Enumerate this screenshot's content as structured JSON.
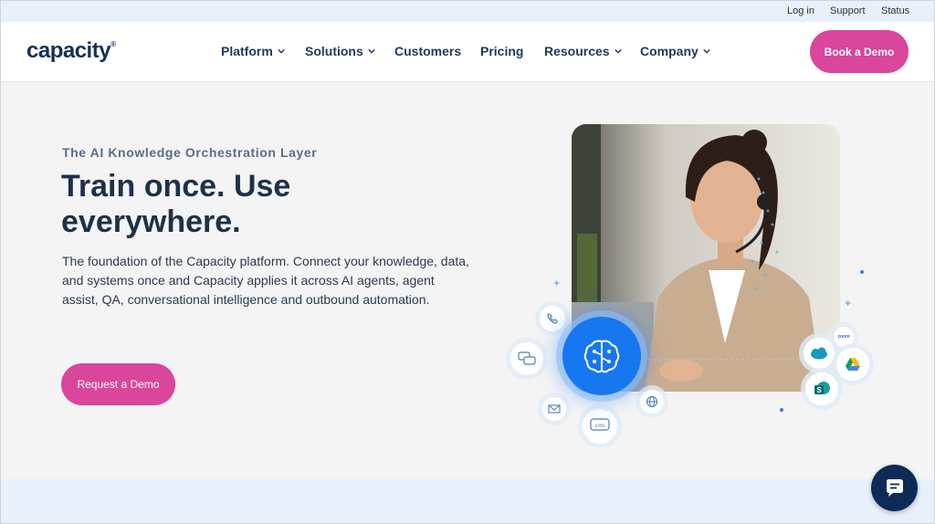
{
  "utility": {
    "login": "Log in",
    "support": "Support",
    "status": "Status"
  },
  "brand": {
    "name": "capacity",
    "mark": "®"
  },
  "nav": {
    "platform": "Platform",
    "solutions": "Solutions",
    "customers": "Customers",
    "pricing": "Pricing",
    "resources": "Resources",
    "company": "Company",
    "book_demo": "Book a Demo"
  },
  "hero": {
    "eyebrow": "The AI Knowledge Orchestration Layer",
    "headline": "Train once. Use everywhere.",
    "body": "The foundation of the Capacity platform. Connect your knowledge, data, and systems once and Capacity applies it across AI agents, agent assist, QA, conversational intelligence and outbound automation.",
    "cta": "Request a Demo"
  },
  "visual": {
    "sms_label": "sms",
    "sharepoint_label": "S",
    "zoom_label": "zoom"
  },
  "colors": {
    "brand_pink": "#d9469b",
    "navy": "#16305a",
    "accent_blue": "#1677f0"
  },
  "icons": [
    "chevron-down-icon",
    "brain-icon",
    "phone-icon",
    "chat-icon",
    "mail-icon",
    "sms-icon",
    "globe-icon",
    "salesforce-icon",
    "google-drive-icon",
    "sharepoint-icon",
    "zoom-icon",
    "chat-widget-icon"
  ]
}
